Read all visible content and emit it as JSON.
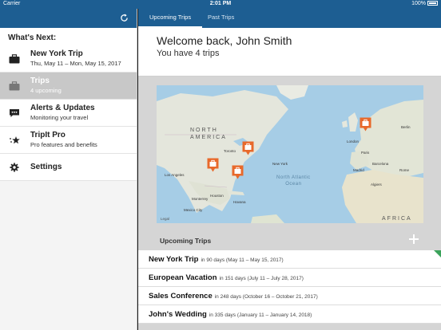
{
  "status_bar": {
    "carrier": "Carrier",
    "time": "2:01 PM",
    "battery": "100%"
  },
  "sidebar": {
    "heading": "What's Next:",
    "items": [
      {
        "title": "New York Trip",
        "subtitle": "Thu, May 11 – Mon, May 15, 2017",
        "icon": "suitcase-icon"
      },
      {
        "title": "Trips",
        "subtitle": "4 upcoming",
        "icon": "suitcase-icon",
        "selected": true
      },
      {
        "title": "Alerts & Updates",
        "subtitle": "Monitoring your travel",
        "icon": "chat-bubble-icon"
      },
      {
        "title": "TripIt Pro",
        "subtitle": "Pro features and benefits",
        "icon": "stars-icon"
      },
      {
        "title": "Settings",
        "subtitle": "",
        "icon": "gear-icon"
      }
    ]
  },
  "tabs": {
    "upcoming": "Upcoming Trips",
    "past": "Past Trips"
  },
  "welcome": {
    "title": "Welcome back, John Smith",
    "subtitle": "You have 4 trips"
  },
  "map": {
    "labels": {
      "north_america": "NORTH\nAMERICA",
      "north_atlantic": "North Atlantic\nOcean",
      "africa": "AFRICA",
      "legal": "Legal"
    },
    "cities": [
      "Toronto",
      "New York",
      "Los Angeles",
      "Houston",
      "Mexico City",
      "Havana",
      "London",
      "Paris",
      "Madrid",
      "Rome",
      "Algiers",
      "Barcelona",
      "Berlin",
      "Monterrey"
    ]
  },
  "upcoming": {
    "header": "Upcoming Trips",
    "trips": [
      {
        "name": "New York Trip",
        "meta": "in 90 days (May 11 – May 15, 2017)"
      },
      {
        "name": "European Vacation",
        "meta": "in 151 days (July 11 – July 28, 2017)"
      },
      {
        "name": "Sales Conference",
        "meta": "in 248 days (October 16 – October 21, 2017)"
      },
      {
        "name": "John's Wedding",
        "meta": "in 335 days (January 11 – January 14, 2018)"
      }
    ]
  },
  "colors": {
    "header_blue": "#1d5e92",
    "pin_orange": "#e8692b",
    "new_flag_green": "#3ba35b"
  }
}
